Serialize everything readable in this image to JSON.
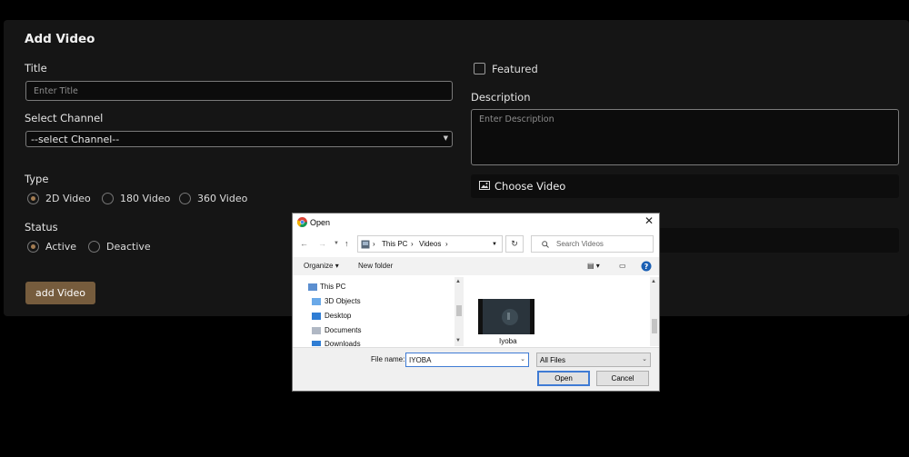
{
  "form": {
    "title": "Add Video",
    "title_label": "Title",
    "title_placeholder": "Enter Title",
    "channel_label": "Select Channel",
    "channel_value": "--select Channel--",
    "type_label": "Type",
    "type_options": [
      "2D Video",
      "180 Video",
      "360 Video"
    ],
    "status_label": "Status",
    "status_options": [
      "Active",
      "Deactive"
    ],
    "featured_label": "Featured",
    "description_label": "Description",
    "description_placeholder": "Enter Description",
    "choose_video_label": "Choose Video",
    "submit_label": "add Video"
  },
  "dialog": {
    "title": "Open",
    "path": [
      "This PC",
      "Videos"
    ],
    "search_placeholder": "Search Videos",
    "organize_label": "Organize",
    "new_folder_label": "New folder",
    "tree": [
      "This PC",
      "3D Objects",
      "Desktop",
      "Documents",
      "Downloads"
    ],
    "files": [
      {
        "name": "Iyoba"
      }
    ],
    "file_name_label": "File name:",
    "file_name_value": "IYOBA",
    "filter_value": "All Files",
    "open_label": "Open",
    "cancel_label": "Cancel"
  },
  "colors": {
    "accent": "#765c3d",
    "radio_selected": "#a37c52",
    "card": "#151515"
  }
}
